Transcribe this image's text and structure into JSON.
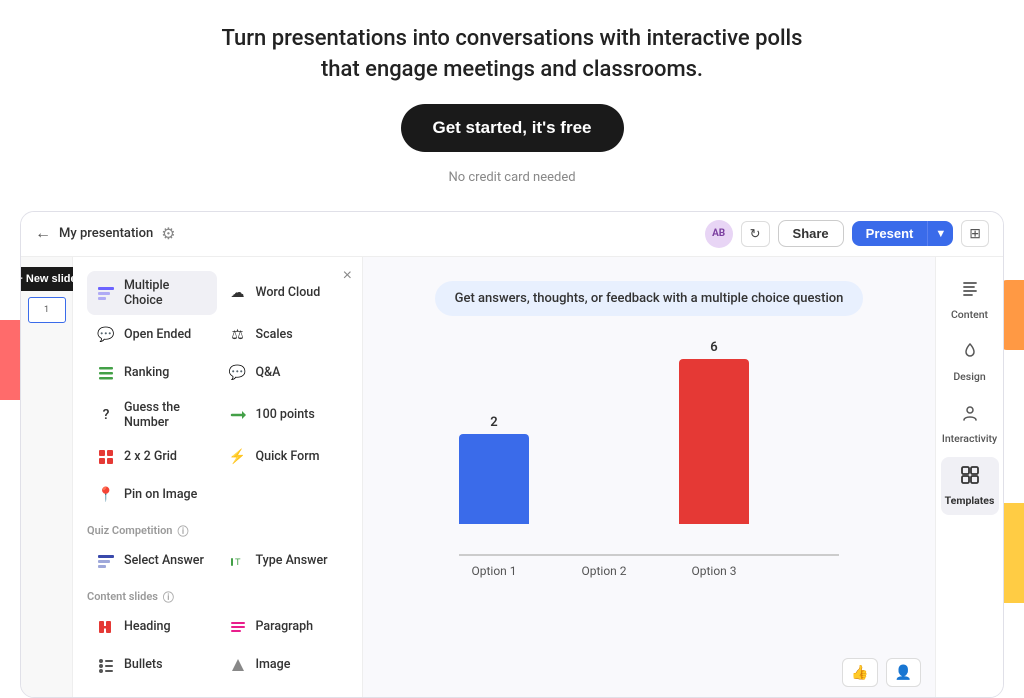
{
  "hero": {
    "title_line1": "Turn presentations into conversations with interactive polls",
    "title_line2": "that engage meetings and classrooms.",
    "cta_label": "Get started, it's free",
    "subtitle": "No credit card needed"
  },
  "topbar": {
    "back_icon": "←",
    "presentation_title": "My presentation",
    "settings_icon": "⚙",
    "avatar": "AB",
    "refresh_icon": "↻",
    "share_label": "Share",
    "present_label": "Present",
    "caret": "▼",
    "grid_icon": "⊞"
  },
  "new_slide": {
    "label": "+ New slide"
  },
  "slide_panel": {
    "close_icon": "×",
    "types": [
      {
        "id": "multiple-choice",
        "label": "Multiple Choice",
        "icon": "📊",
        "color": "#6c63ff",
        "active": true
      },
      {
        "id": "word-cloud",
        "label": "Word Cloud",
        "icon": "☁",
        "color": "#e53935"
      },
      {
        "id": "open-ended",
        "label": "Open Ended",
        "icon": "💬",
        "color": "#e91e8c"
      },
      {
        "id": "scales",
        "label": "Scales",
        "icon": "⚖",
        "color": "#3949ab"
      },
      {
        "id": "ranking",
        "label": "Ranking",
        "icon": "↕",
        "color": "#43a047"
      },
      {
        "id": "qa",
        "label": "Q&A",
        "icon": "❓",
        "color": "#e91e8c"
      },
      {
        "id": "guess-number",
        "label": "Guess the Number",
        "icon": "?",
        "color": "#ff9800"
      },
      {
        "id": "100-points",
        "label": "100 points",
        "icon": "⟶",
        "color": "#43a047"
      },
      {
        "id": "2x2-grid",
        "label": "2 x 2 Grid",
        "icon": "⊞",
        "color": "#e53935"
      },
      {
        "id": "quick-form",
        "label": "Quick Form",
        "icon": "⚡",
        "color": "#ff9800"
      },
      {
        "id": "pin-on-image",
        "label": "Pin on Image",
        "icon": "📍",
        "color": "#555"
      }
    ],
    "quiz_section": "Quiz Competition",
    "quiz_types": [
      {
        "id": "select-answer",
        "label": "Select Answer",
        "icon": "📊",
        "color": "#3949ab"
      },
      {
        "id": "type-answer",
        "label": "Type Answer",
        "icon": "T",
        "color": "#43a047"
      }
    ],
    "content_section": "Content slides",
    "content_types": [
      {
        "id": "heading",
        "label": "Heading",
        "icon": "■",
        "color": "#e53935"
      },
      {
        "id": "paragraph",
        "label": "Paragraph",
        "icon": "■",
        "color": "#e91e8c"
      },
      {
        "id": "bullets",
        "label": "Bullets",
        "icon": "⋮",
        "color": "#555"
      },
      {
        "id": "image",
        "label": "Image",
        "icon": "▲",
        "color": "#555"
      }
    ]
  },
  "canvas": {
    "hint": "Get answers, thoughts, or feedback with a multiple choice question",
    "chart": {
      "bars": [
        {
          "label": "Option 1",
          "value": 2,
          "color": "#3a6bea",
          "height": 90
        },
        {
          "label": "Option 2",
          "value": 0,
          "color": "#aaa",
          "height": 0
        },
        {
          "label": "Option 3",
          "value": 6,
          "color": "#e53935",
          "height": 165
        }
      ]
    },
    "thumbs_up_icon": "👍",
    "person_icon": "👤"
  },
  "right_panel": {
    "items": [
      {
        "id": "content",
        "label": "Content",
        "icon": "✏",
        "active": false
      },
      {
        "id": "design",
        "label": "Design",
        "icon": "🎨",
        "active": false
      },
      {
        "id": "interactivity",
        "label": "Interactivity",
        "icon": "👤",
        "active": false
      },
      {
        "id": "templates",
        "label": "Templates",
        "icon": "⊞",
        "active": true
      }
    ]
  },
  "slide_number": "1"
}
